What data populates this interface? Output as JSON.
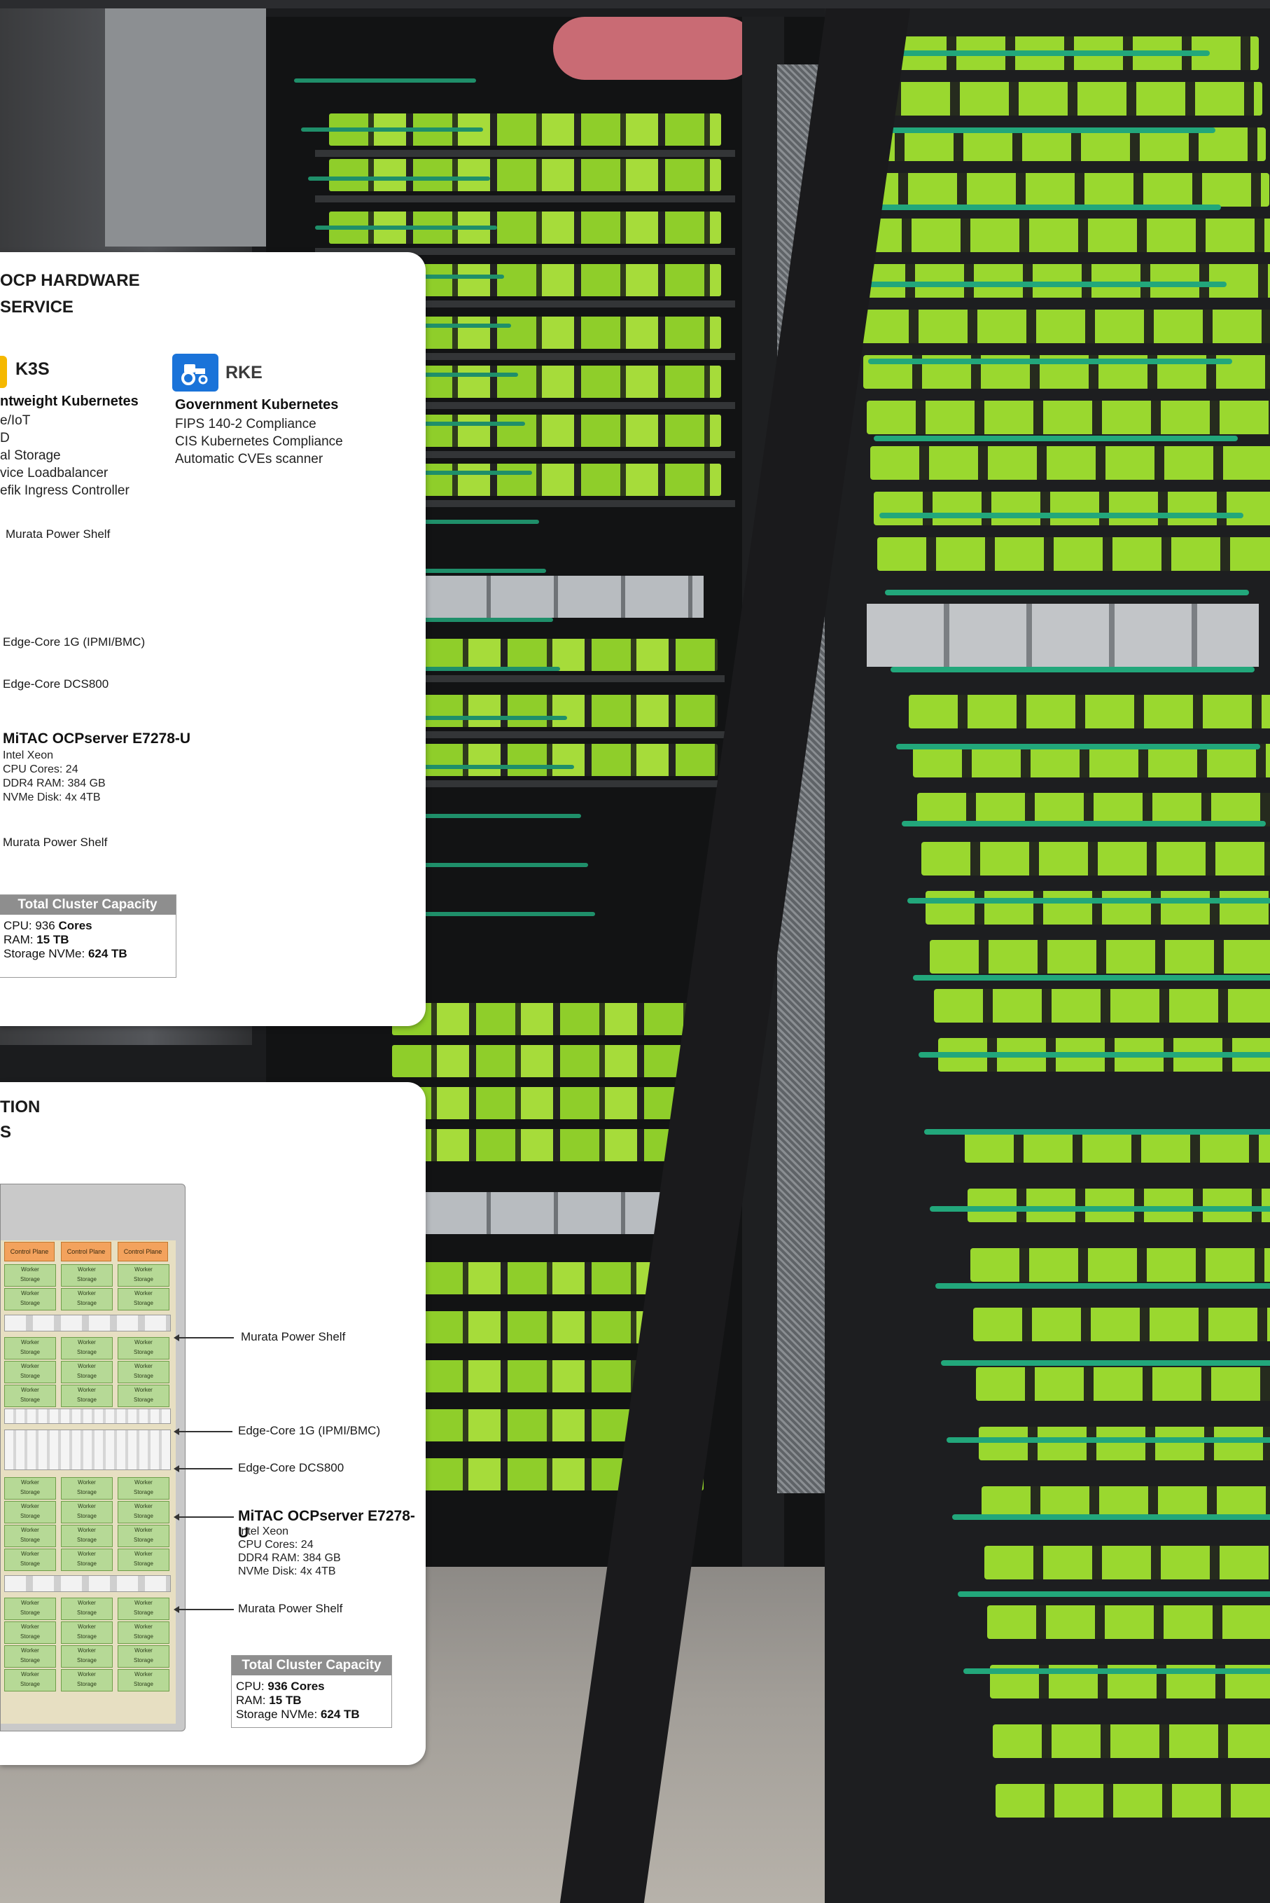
{
  "card1": {
    "heading_line1": "OCP HARDWARE",
    "heading_line2": "SERVICE",
    "k3s": {
      "brand": "K3S",
      "title": "ntweight Kubernetes",
      "features": [
        "e/IoT",
        "D",
        "al Storage",
        "vice Loadbalancer",
        "efik Ingress Controller"
      ]
    },
    "rke": {
      "brand": "RKE",
      "title": "Government Kubernetes",
      "features": [
        "FIPS 140-2 Compliance",
        "CIS Kubernetes Compliance",
        "Automatic CVEs scanner"
      ]
    },
    "labels": {
      "power_shelf_top": "Murata Power Shelf",
      "switch_1g": "Edge-Core 1G (IPMI/BMC)",
      "switch_dcs": "Edge-Core DCS800",
      "power_shelf_bottom": "Murata Power Shelf"
    },
    "server": {
      "title": "MiTAC OCPserver E7278-U",
      "specs": [
        "Intel Xeon",
        "CPU Cores: 24",
        "DDR4 RAM: 384 GB",
        "NVMe Disk: 4x 4TB"
      ]
    },
    "capacity": {
      "title": "Total Cluster Capacity",
      "cpu_label": "CPU: 936 ",
      "cpu_value": "Cores",
      "ram_label": "RAM: ",
      "ram_value": "15 TB",
      "storage_label": "Storage NVMe: ",
      "storage_value": "624 TB"
    }
  },
  "card2": {
    "heading_line1": "TION",
    "heading_line2": "S",
    "diagram": {
      "control_plane": "Control Plane",
      "worker": "Worker",
      "storage": "Storage"
    },
    "labels": {
      "power_shelf_top": "Murata Power Shelf",
      "switch_1g": "Edge-Core 1G (IPMI/BMC)",
      "switch_dcs": "Edge-Core DCS800",
      "power_shelf_bottom": "Murata Power Shelf"
    },
    "server": {
      "title": "MiTAC OCPserver E7278-U",
      "specs": [
        "Intel Xeon",
        "CPU Cores: 24",
        "DDR4 RAM: 384 GB",
        "NVMe Disk: 4x 4TB"
      ]
    },
    "capacity": {
      "title": "Total Cluster Capacity",
      "cpu_label": "CPU: ",
      "cpu_value": "936 Cores",
      "ram_label": "RAM: ",
      "ram_value": "15 TB",
      "storage_label": "Storage NVMe: ",
      "storage_value": "624 TB"
    }
  },
  "colors": {
    "k3s_logo": "#f5b800",
    "rke_logo": "#1a73d9",
    "control_plane": "#f3a25d",
    "worker_node": "#b6d996",
    "capacity_header": "#8e8e8e",
    "cable_green": "#1f8f6a",
    "server_green": "#8fce2a"
  },
  "icons": {
    "k3s": "k3s-logo-icon",
    "rke": "rke-tractor-icon"
  }
}
